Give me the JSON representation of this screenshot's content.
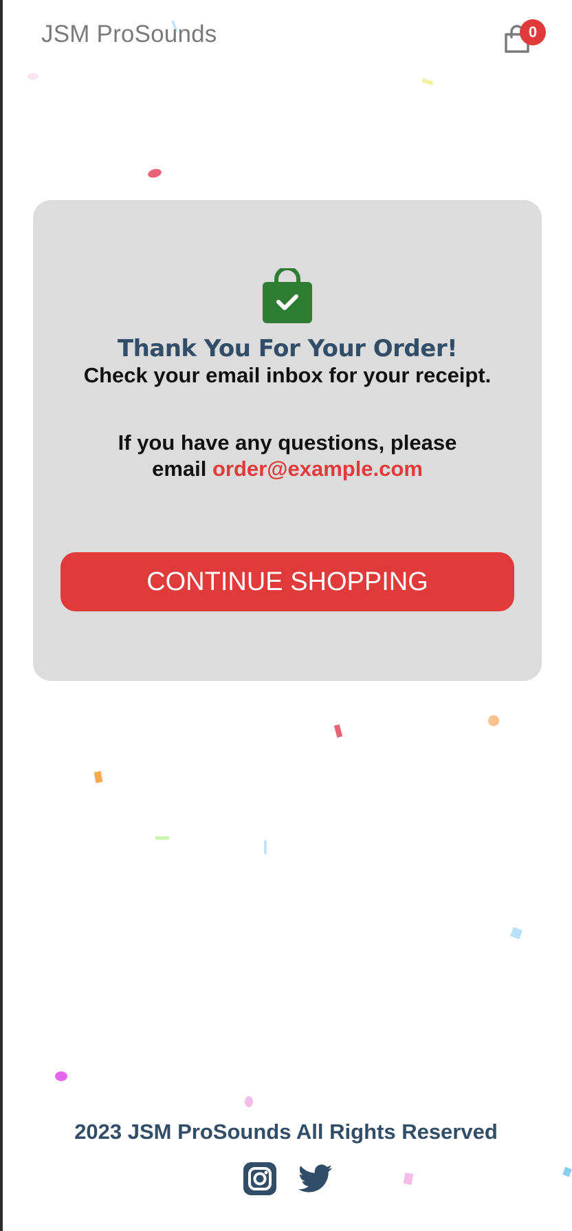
{
  "navbar": {
    "logo": "JSM ProSounds",
    "cart_count": "0",
    "cart_icon": "shopping-bag-icon"
  },
  "success": {
    "icon": "bag-check-icon",
    "title": "Thank You For Your Order!",
    "email_msg": "Check your email inbox for your receipt.",
    "description_prefix": "If you have any questions, please email",
    "contact_email": "order@example.com",
    "button_label": "CONTINUE SHOPPING"
  },
  "footer": {
    "copyright": "2023 JSM ProSounds All Rights Reserved",
    "social": [
      "instagram-icon",
      "twitter-icon"
    ]
  },
  "colors": {
    "accent": "#e03a3a",
    "heading": "#324d67",
    "card_bg": "#dcdcdc",
    "bag_green": "#2e7d32"
  }
}
